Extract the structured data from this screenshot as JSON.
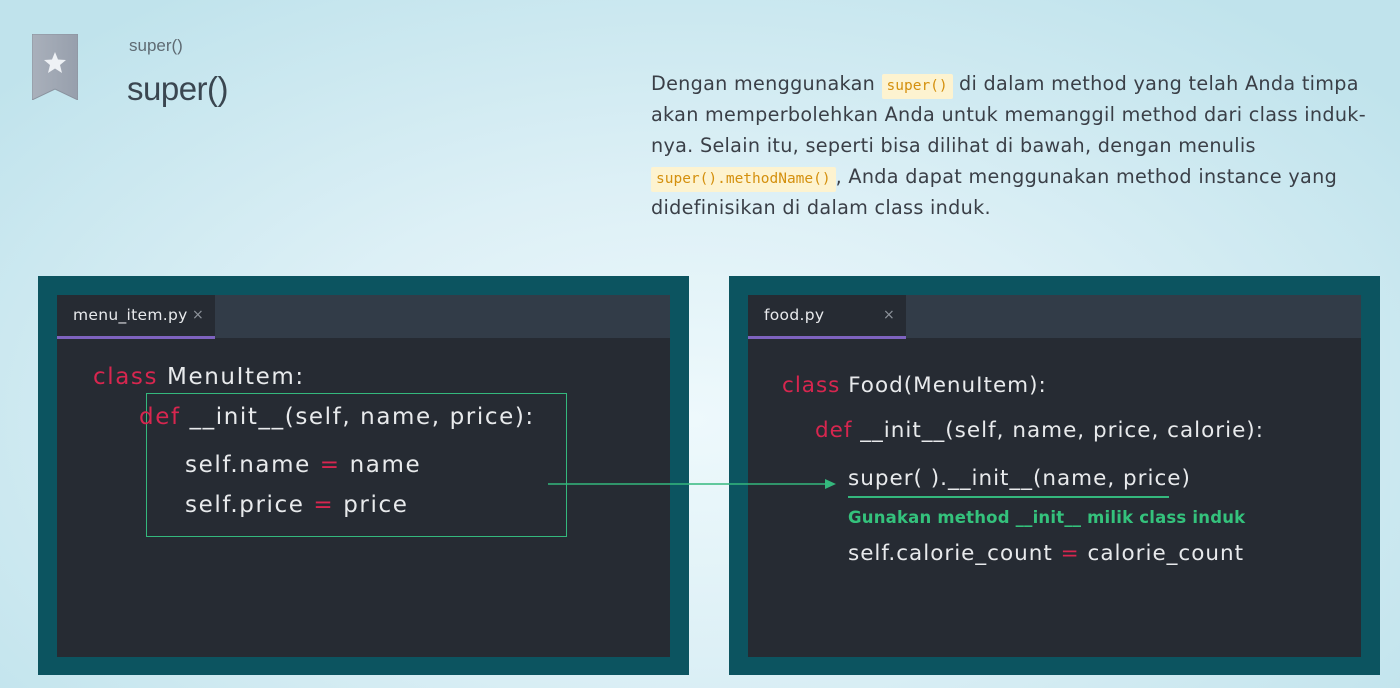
{
  "header": {
    "breadcrumb": "super()",
    "title": "super()"
  },
  "description": {
    "line1_before": "Dengan menggunakan ",
    "line1_code": "super()",
    "line1_after": " di dalam method yang telah Anda timpa",
    "line2": "akan memperbolehkan Anda untuk memanggil method dari class induk-",
    "line3": "nya. Selain itu, seperti bisa dilihat di bawah, dengan menulis",
    "line4_code": "super().methodName()",
    "line4_after": ", Anda dapat menggunakan method instance yang",
    "line5": "didefinisikan di dalam class induk."
  },
  "left_editor": {
    "tab": "menu_item.py",
    "close": "×",
    "line1_kw": "class",
    "line1_rest": " MenuItem:",
    "line2_kw": "def",
    "line2_rest": "  __init__(self, name, price):",
    "line3_a": "self.name ",
    "line3_op": "=",
    "line3_b": " name",
    "line4_a": "self.price ",
    "line4_op": "=",
    "line4_b": " price"
  },
  "right_editor": {
    "tab": "food.py",
    "close": "×",
    "line1_kw": "class",
    "line1_rest": " Food(MenuItem):",
    "line2_kw": "def",
    "line2_rest": "  __init__(self, name, price, calorie):",
    "line3": "super( ).__init__(name, price)",
    "annotation": "Gunakan method __init__ milik class induk",
    "line5_a": "self.calorie_count ",
    "line5_op": "=",
    "line5_b": " calorie_count"
  },
  "colors": {
    "keyword": "#d7264f",
    "accent_green": "#34b87d",
    "tab_underline": "#7e63bf",
    "panel_frame": "#0c5460",
    "editor_bg": "#262b33",
    "inline_code_bg": "#fdf3d0",
    "inline_code_text": "#d4900e"
  },
  "icons": {
    "bookmark": "bookmark-star-icon",
    "close": "close-icon",
    "arrow": "arrow-right-icon"
  }
}
